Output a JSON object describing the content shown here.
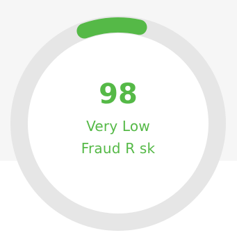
{
  "gauge": {
    "score": "98",
    "rating_line1": "Very Low",
    "rating_line2": "Fraud R sk",
    "progress_percent": 9,
    "colors": {
      "accent": "#55b947",
      "track": "#e6e6e6",
      "inner": "#ffffff",
      "background": "#f6f6f6"
    }
  }
}
